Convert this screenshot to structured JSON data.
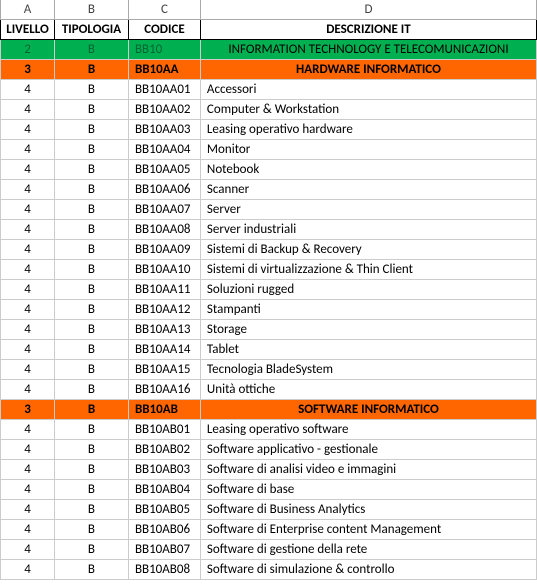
{
  "columns": {
    "a": "A",
    "b": "B",
    "c": "C",
    "d": "D"
  },
  "headers": {
    "a": "LIVELLO",
    "b": "TIPOLOGIA",
    "c": "CODICE",
    "d": "DESCRIZIONE IT"
  },
  "rows": [
    {
      "lvl": "2",
      "tip": "B",
      "cod": "BB10",
      "desc": "INFORMATION TECHNOLOGY E TELECOMUNICAZIONI",
      "cls": "lvl2"
    },
    {
      "lvl": "3",
      "tip": "B",
      "cod": "BB10AA",
      "desc": "HARDWARE INFORMATICO",
      "cls": "lvl3"
    },
    {
      "lvl": "4",
      "tip": "B",
      "cod": "BB10AA01",
      "desc": "Accessori",
      "cls": ""
    },
    {
      "lvl": "4",
      "tip": "B",
      "cod": "BB10AA02",
      "desc": "Computer & Workstation",
      "cls": ""
    },
    {
      "lvl": "4",
      "tip": "B",
      "cod": "BB10AA03",
      "desc": "Leasing operativo hardware",
      "cls": ""
    },
    {
      "lvl": "4",
      "tip": "B",
      "cod": "BB10AA04",
      "desc": "Monitor",
      "cls": ""
    },
    {
      "lvl": "4",
      "tip": "B",
      "cod": "BB10AA05",
      "desc": "Notebook",
      "cls": ""
    },
    {
      "lvl": "4",
      "tip": "B",
      "cod": "BB10AA06",
      "desc": "Scanner",
      "cls": ""
    },
    {
      "lvl": "4",
      "tip": "B",
      "cod": "BB10AA07",
      "desc": "Server",
      "cls": ""
    },
    {
      "lvl": "4",
      "tip": "B",
      "cod": "BB10AA08",
      "desc": "Server industriali",
      "cls": ""
    },
    {
      "lvl": "4",
      "tip": "B",
      "cod": "BB10AA09",
      "desc": "Sistemi di Backup & Recovery",
      "cls": ""
    },
    {
      "lvl": "4",
      "tip": "B",
      "cod": "BB10AA10",
      "desc": "Sistemi di virtualizzazione & Thin Client",
      "cls": ""
    },
    {
      "lvl": "4",
      "tip": "B",
      "cod": "BB10AA11",
      "desc": "Soluzioni rugged",
      "cls": ""
    },
    {
      "lvl": "4",
      "tip": "B",
      "cod": "BB10AA12",
      "desc": "Stampanti",
      "cls": ""
    },
    {
      "lvl": "4",
      "tip": "B",
      "cod": "BB10AA13",
      "desc": "Storage",
      "cls": ""
    },
    {
      "lvl": "4",
      "tip": "B",
      "cod": "BB10AA14",
      "desc": "Tablet",
      "cls": ""
    },
    {
      "lvl": "4",
      "tip": "B",
      "cod": "BB10AA15",
      "desc": "Tecnologia BladeSystem",
      "cls": ""
    },
    {
      "lvl": "4",
      "tip": "B",
      "cod": "BB10AA16",
      "desc": "Unità ottiche",
      "cls": ""
    },
    {
      "lvl": "3",
      "tip": "B",
      "cod": "BB10AB",
      "desc": "SOFTWARE INFORMATICO",
      "cls": "lvl3"
    },
    {
      "lvl": "4",
      "tip": "B",
      "cod": "BB10AB01",
      "desc": "Leasing operativo software",
      "cls": ""
    },
    {
      "lvl": "4",
      "tip": "B",
      "cod": "BB10AB02",
      "desc": "Software applicativo - gestionale",
      "cls": ""
    },
    {
      "lvl": "4",
      "tip": "B",
      "cod": "BB10AB03",
      "desc": "Software di analisi video e immagini",
      "cls": ""
    },
    {
      "lvl": "4",
      "tip": "B",
      "cod": "BB10AB04",
      "desc": "Software di base",
      "cls": ""
    },
    {
      "lvl": "4",
      "tip": "B",
      "cod": "BB10AB05",
      "desc": "Software di Business Analytics",
      "cls": ""
    },
    {
      "lvl": "4",
      "tip": "B",
      "cod": "BB10AB06",
      "desc": "Software di Enterprise content Management",
      "cls": ""
    },
    {
      "lvl": "4",
      "tip": "B",
      "cod": "BB10AB07",
      "desc": "Software di gestione della rete",
      "cls": ""
    },
    {
      "lvl": "4",
      "tip": "B",
      "cod": "BB10AB08",
      "desc": "Software di simulazione & controllo",
      "cls": ""
    }
  ]
}
